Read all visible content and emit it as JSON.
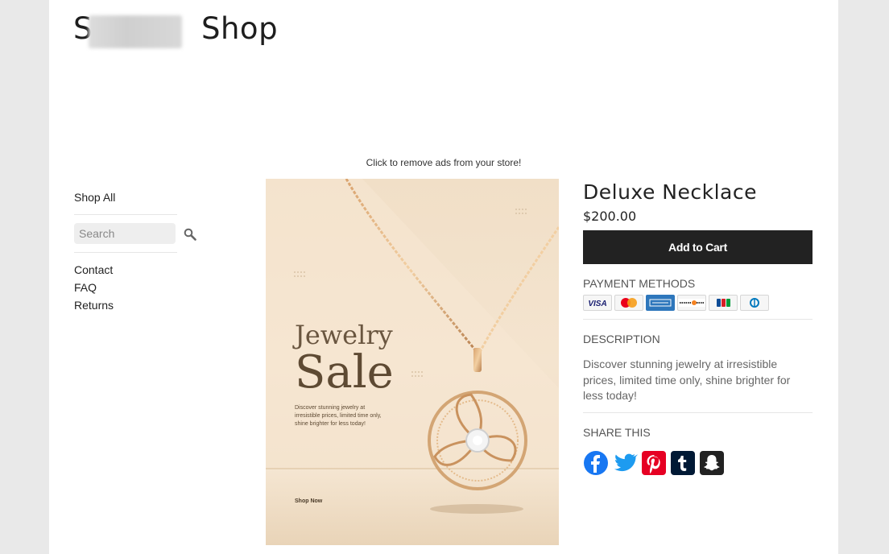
{
  "header": {
    "logo_prefix": "S",
    "logo_suffix": "Shop"
  },
  "ad_notice": "Click to remove ads from your store!",
  "sidebar": {
    "shop_all": "Shop All",
    "search_placeholder": "Search",
    "links": [
      "Contact",
      "FAQ",
      "Returns"
    ]
  },
  "product_image": {
    "headline_1": "Jewelry",
    "headline_2": "Sale",
    "tagline": "Discover stunning jewelry at irresistible prices, limited time only, shine brighter for less today!",
    "cta": "Shop Now"
  },
  "product": {
    "title": "Deluxe Necklace",
    "price": "$200.00",
    "add_to_cart": "Add to Cart",
    "payment_label": "PAYMENT METHODS",
    "payment_cards": [
      "visa-icon",
      "mastercard-icon",
      "amex-icon",
      "discover-icon",
      "jcb-icon",
      "diners-icon"
    ],
    "description_label": "DESCRIPTION",
    "description": "Discover stunning jewelry at irresistible prices, limited time only, shine brighter for less today!",
    "share_label": "SHARE THIS",
    "share": [
      "facebook-icon",
      "twitter-icon",
      "pinterest-icon",
      "tumblr-icon",
      "snapchat-icon"
    ]
  },
  "colors": {
    "background": "#e9e9e9",
    "button": "#222222",
    "facebook": "#1877f2",
    "twitter": "#1d9bf0",
    "pinterest": "#e60023",
    "tumblr": "#001935",
    "snapchat": "#222222"
  }
}
